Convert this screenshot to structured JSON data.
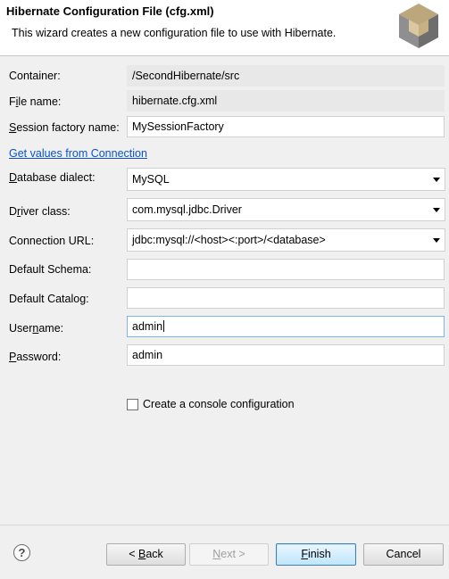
{
  "header": {
    "title": "Hibernate Configuration File (cfg.xml)",
    "description": "This wizard creates a new configuration file to use with Hibernate."
  },
  "form": {
    "container": {
      "label_first": "C",
      "label_rest": "ontainer:",
      "value": "/SecondHibernate/src"
    },
    "file_name": {
      "label_first": "F",
      "label_mid": "i",
      "label_rest": "le name:",
      "value": "hibernate.cfg.xml"
    },
    "session_factory": {
      "label_first": "S",
      "label_rest": "ession factory name:",
      "value": "MySessionFactory"
    },
    "get_values_link": "Get values from Connection",
    "dialect": {
      "label_first": "D",
      "label_rest": "atabase dialect:",
      "value": "MySQL"
    },
    "driver": {
      "label_pre": "D",
      "label_u": "r",
      "label_rest": "iver class:",
      "value": "com.mysql.jdbc.Driver"
    },
    "connection_url": {
      "label": "Connection URL:",
      "value": "jdbc:mysql://<host><:port>/<database>"
    },
    "default_schema": {
      "label": "Default Schema:",
      "value": ""
    },
    "default_catalog": {
      "label": "Default Catalog:",
      "value": ""
    },
    "username": {
      "label_pre": "User",
      "label_u": "n",
      "label_rest": "ame:",
      "value": "admin"
    },
    "password": {
      "label_first": "P",
      "label_rest": "assword:",
      "value": "admin"
    },
    "console_checkbox": {
      "label": "Create a console configuration",
      "checked": false
    }
  },
  "buttons": {
    "help": "?",
    "back_pre": "< ",
    "back_u": "B",
    "back_rest": "ack",
    "next_u": "N",
    "next_rest": "ext >",
    "finish_u": "F",
    "finish_rest": "inish",
    "cancel": "Cancel"
  },
  "colors": {
    "link": "#0a52c8",
    "default_button_border": "#3c7fb1",
    "header_bg": "#ffffff",
    "dialog_bg": "#f0f0f0"
  }
}
